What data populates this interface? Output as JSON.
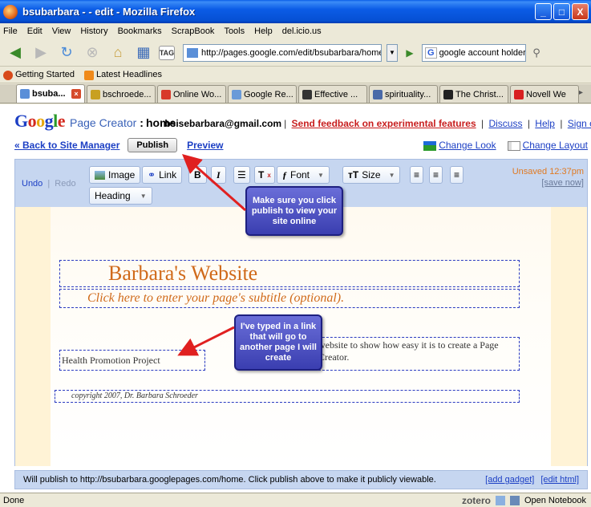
{
  "window": {
    "title": "bsubarbara - - edit - Mozilla Firefox",
    "min": "_",
    "max": "□",
    "close": "X"
  },
  "menu": [
    "File",
    "Edit",
    "View",
    "History",
    "Bookmarks",
    "ScrapBook",
    "Tools",
    "Help",
    "del.icio.us"
  ],
  "nav": {
    "url": "http://pages.google.com/edit/bsubarbara/home?authtoken=46e",
    "search_value": "google account holder",
    "search_engine": "G",
    "tag_label": "TAG"
  },
  "bookmarks": [
    "Getting Started",
    "Latest Headlines"
  ],
  "tabs": [
    {
      "label": "bsuba...",
      "active": true,
      "color": "#5a8fd8"
    },
    {
      "label": "bschroede...",
      "active": false,
      "color": "#c8a020"
    },
    {
      "label": "Online Wo...",
      "active": false,
      "color": "#d83a2a"
    },
    {
      "label": "Google Re...",
      "active": false,
      "color": "#6a9ad8"
    },
    {
      "label": "Effective ...",
      "active": false,
      "color": "#333333"
    },
    {
      "label": "spirituality...",
      "active": false,
      "color": "#4a6aa8"
    },
    {
      "label": "The Christ...",
      "active": false,
      "color": "#222222"
    },
    {
      "label": "Novell We",
      "active": false,
      "color": "#d82020"
    }
  ],
  "header": {
    "product": "Page Creator",
    "colon": ":",
    "site": "home",
    "email": "bsisebarbara@gmail.com",
    "sep": "|",
    "feedback": "Send feedback on experimental features",
    "discuss": "Discuss",
    "help": "Help",
    "signout": "Sign out"
  },
  "subnav": {
    "back": "« Back to Site Manager",
    "publish": "Publish",
    "preview": "Preview",
    "change_look": "Change Look",
    "change_layout": "Change Layout"
  },
  "editor": {
    "undo": "Undo",
    "redo": "Redo",
    "image": "Image",
    "link": "Link",
    "bold": "B",
    "italic": "I",
    "font": "Font",
    "size": "Size",
    "heading": "Heading",
    "unsaved": "Unsaved 12:37pm",
    "save_now": "[save now]"
  },
  "canvas": {
    "site_title": "Barbara's Website",
    "subtitle": "Click here to enter your page's subtitle (optional).",
    "side_link": "Health Promotion Project",
    "main_text": "website to show how easy it is to create a Page Creator.",
    "footer": "copyright 2007, Dr. Barbara Schroeder"
  },
  "callouts": {
    "c1": "Make sure you click publish to view your site online",
    "c2": "I've typed in a link that will go to another page I will create"
  },
  "status_line": {
    "text": "Will publish to http://bsubarbara.googlepages.com/home. Click publish above to make it publicly viewable.",
    "add_gadget": "[add gadget]",
    "edit_html": "[edit html]"
  },
  "browser_status": {
    "left": "Done",
    "zotero": "zotero",
    "notebook": "Open Notebook"
  }
}
